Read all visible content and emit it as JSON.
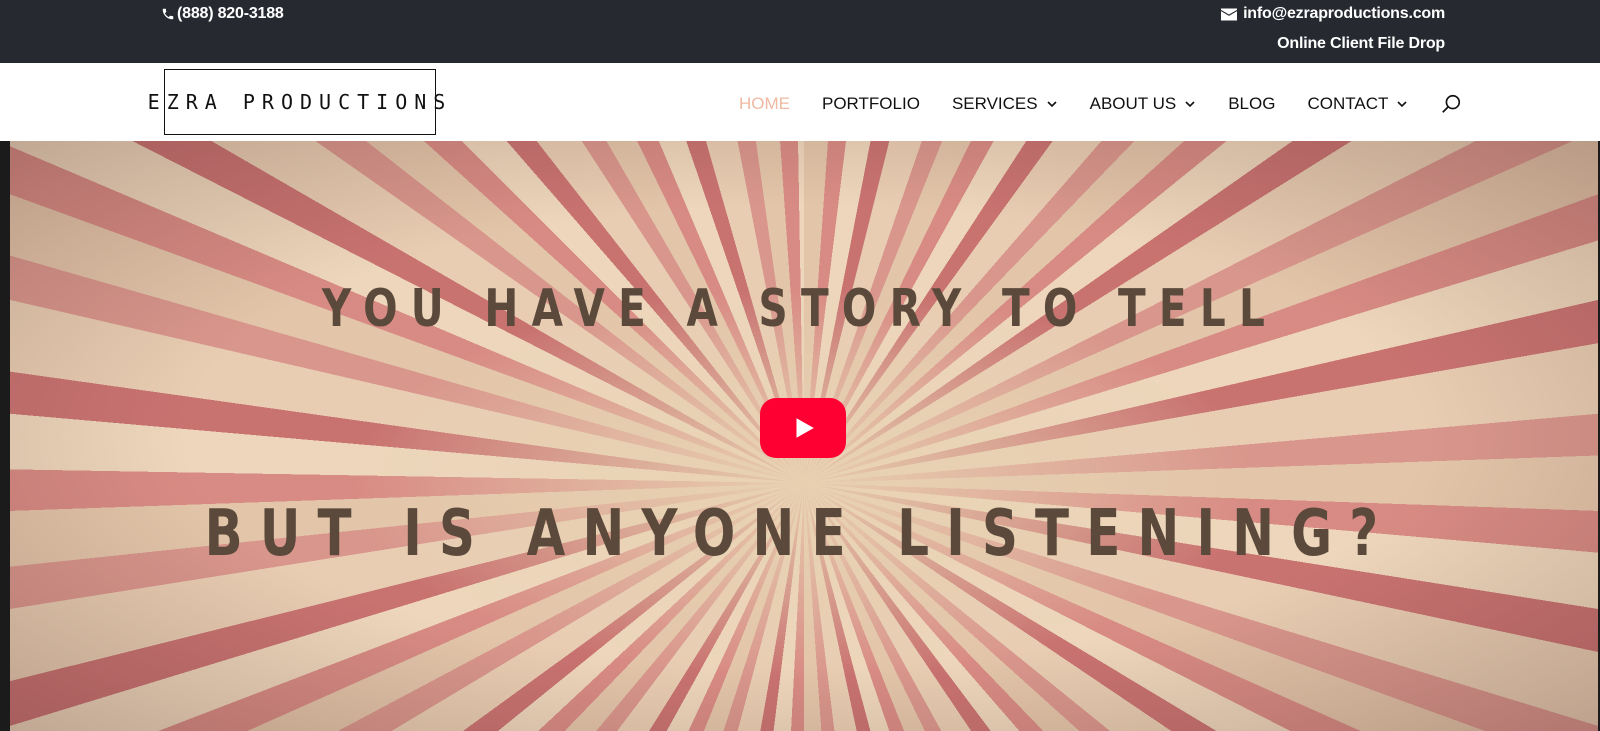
{
  "topbar": {
    "phone": "(888) 820-3188",
    "email": "info@ezraproductions.com",
    "file_drop": "Online Client File Drop"
  },
  "header": {
    "logo_text": "EZRA PRODUCTIONS",
    "nav": {
      "home": "HOME",
      "portfolio": "PORTFOLIO",
      "services": "SERVICES",
      "about": "ABOUT US",
      "blog": "BLOG",
      "contact": "CONTACT"
    },
    "active_item": "HOME",
    "icons": [
      "phone-icon",
      "email-icon",
      "chevron-down-icon",
      "search-icon"
    ]
  },
  "hero": {
    "headline_top": "YOU HAVE A STORY TO TELL",
    "headline_bottom": "BUT IS ANYONE LISTENING?",
    "play_icon": "youtube-play-icon"
  },
  "colors": {
    "topbar_bg": "#262a30",
    "nav_active": "#f0b9a0",
    "play_button": "#ff0033",
    "headline": "#5b4a3c"
  }
}
